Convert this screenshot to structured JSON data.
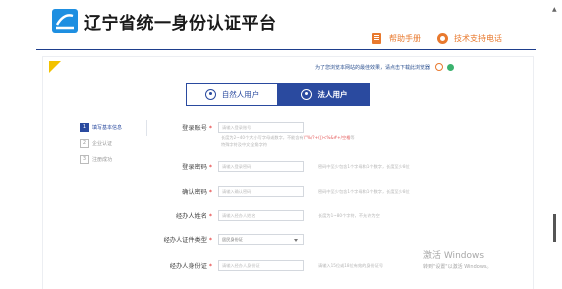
{
  "header": {
    "title": "辽宁省统一身份认证平台",
    "help_manual": "帮助手册",
    "tech_support": "技术支持电话"
  },
  "notice": {
    "browser_tip": "为了您浏览本网站的最佳效果，请点击下载此浏览器"
  },
  "user_types": [
    {
      "label": "自然人用户",
      "active": false
    },
    {
      "label": "法人用户",
      "active": true
    }
  ],
  "steps": [
    {
      "num": "1",
      "label": "填写基本信息",
      "active": true
    },
    {
      "num": "2",
      "label": "企业认证",
      "active": false
    },
    {
      "num": "3",
      "label": "注册成功",
      "active": false
    }
  ],
  "form": {
    "account": {
      "label": "登录账号",
      "placeholder": "请输入登录账号",
      "hint_line1": "长度为2~40个大小写字母或数字，不能含有",
      "hint_red": "\\\"%/?+(|)<%&#+/空格",
      "hint_tail": "等",
      "hint_line2": "特殊字符及中文全角字符"
    },
    "password": {
      "label": "登录密码",
      "placeholder": "请输入登录密码",
      "hint": "密码中至少包含1个字母和1个数字，长度至少8位"
    },
    "confirm": {
      "label": "确认密码",
      "placeholder": "请输入确认密码",
      "hint": "密码中至少包含1个字母和1个数字，长度至少8位"
    },
    "agent_name": {
      "label": "经办人姓名",
      "placeholder": "请输入经办人姓名",
      "hint": "长度为1~80个字符，不允许为空"
    },
    "id_type": {
      "label": "经办人证件类型",
      "value": "居民身份证"
    },
    "id_number": {
      "label": "经办人身份证",
      "placeholder": "请输入经办人身份证",
      "hint": "请输入15位或18位有效的身份证号"
    },
    "required_mark": "*"
  },
  "watermark": {
    "line1": "激活 Windows",
    "line2": "转到\"设置\"以激活 Windows。"
  },
  "colors": {
    "brand_blue": "#2a4a9f",
    "accent_orange": "#e8792e",
    "required_red": "#e02020"
  }
}
